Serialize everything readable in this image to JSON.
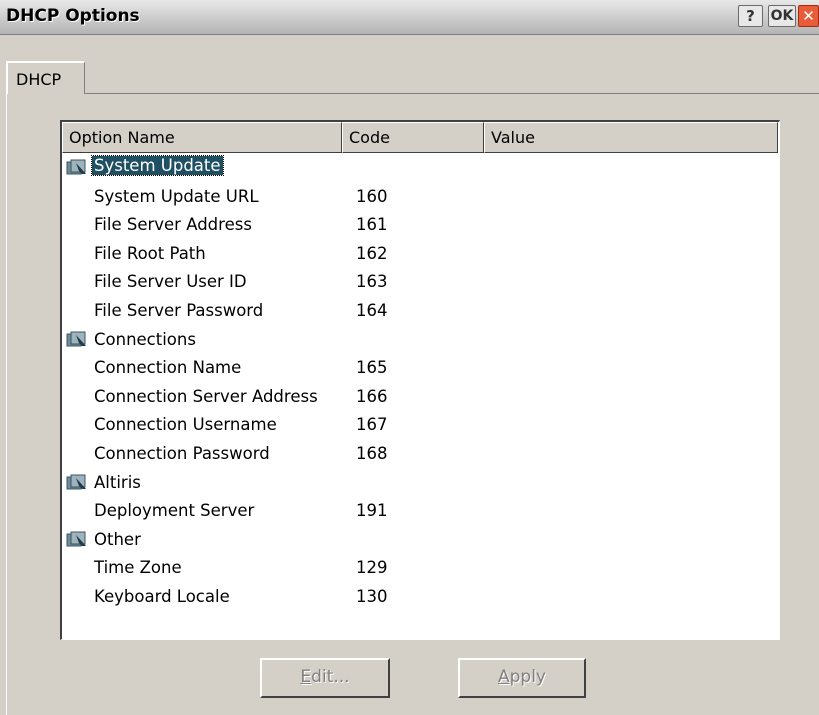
{
  "window": {
    "title": "DHCP Options",
    "help_label": "?",
    "ok_label": "OK",
    "close_label": "✕"
  },
  "tabs": [
    {
      "label": "DHCP",
      "selected": true
    }
  ],
  "list": {
    "columns": [
      "Option Name",
      "Code",
      "Value"
    ],
    "groups": [
      {
        "name": "System Update",
        "selected": true,
        "icon": "group-folder-icon",
        "items": [
          {
            "name": "System Update URL",
            "code": "160",
            "value": ""
          },
          {
            "name": "File Server Address",
            "code": "161",
            "value": ""
          },
          {
            "name": "File Root Path",
            "code": "162",
            "value": ""
          },
          {
            "name": "File Server User ID",
            "code": "163",
            "value": ""
          },
          {
            "name": "File Server Password",
            "code": "164",
            "value": ""
          }
        ]
      },
      {
        "name": "Connections",
        "icon": "group-folder-icon",
        "items": [
          {
            "name": "Connection Name",
            "code": "165",
            "value": ""
          },
          {
            "name": "Connection Server Address",
            "code": "166",
            "value": ""
          },
          {
            "name": "Connection Username",
            "code": "167",
            "value": ""
          },
          {
            "name": "Connection Password",
            "code": "168",
            "value": ""
          }
        ]
      },
      {
        "name": "Altiris",
        "icon": "group-folder-icon",
        "items": [
          {
            "name": "Deployment Server",
            "code": "191",
            "value": ""
          }
        ]
      },
      {
        "name": "Other",
        "icon": "group-folder-icon",
        "items": [
          {
            "name": "Time Zone",
            "code": "129",
            "value": ""
          },
          {
            "name": "Keyboard Locale",
            "code": "130",
            "value": ""
          }
        ]
      }
    ]
  },
  "buttons": {
    "edit_mnemonic": "E",
    "edit_rest": "dit...",
    "apply_mnemonic": "A",
    "apply_rest": "pply"
  }
}
